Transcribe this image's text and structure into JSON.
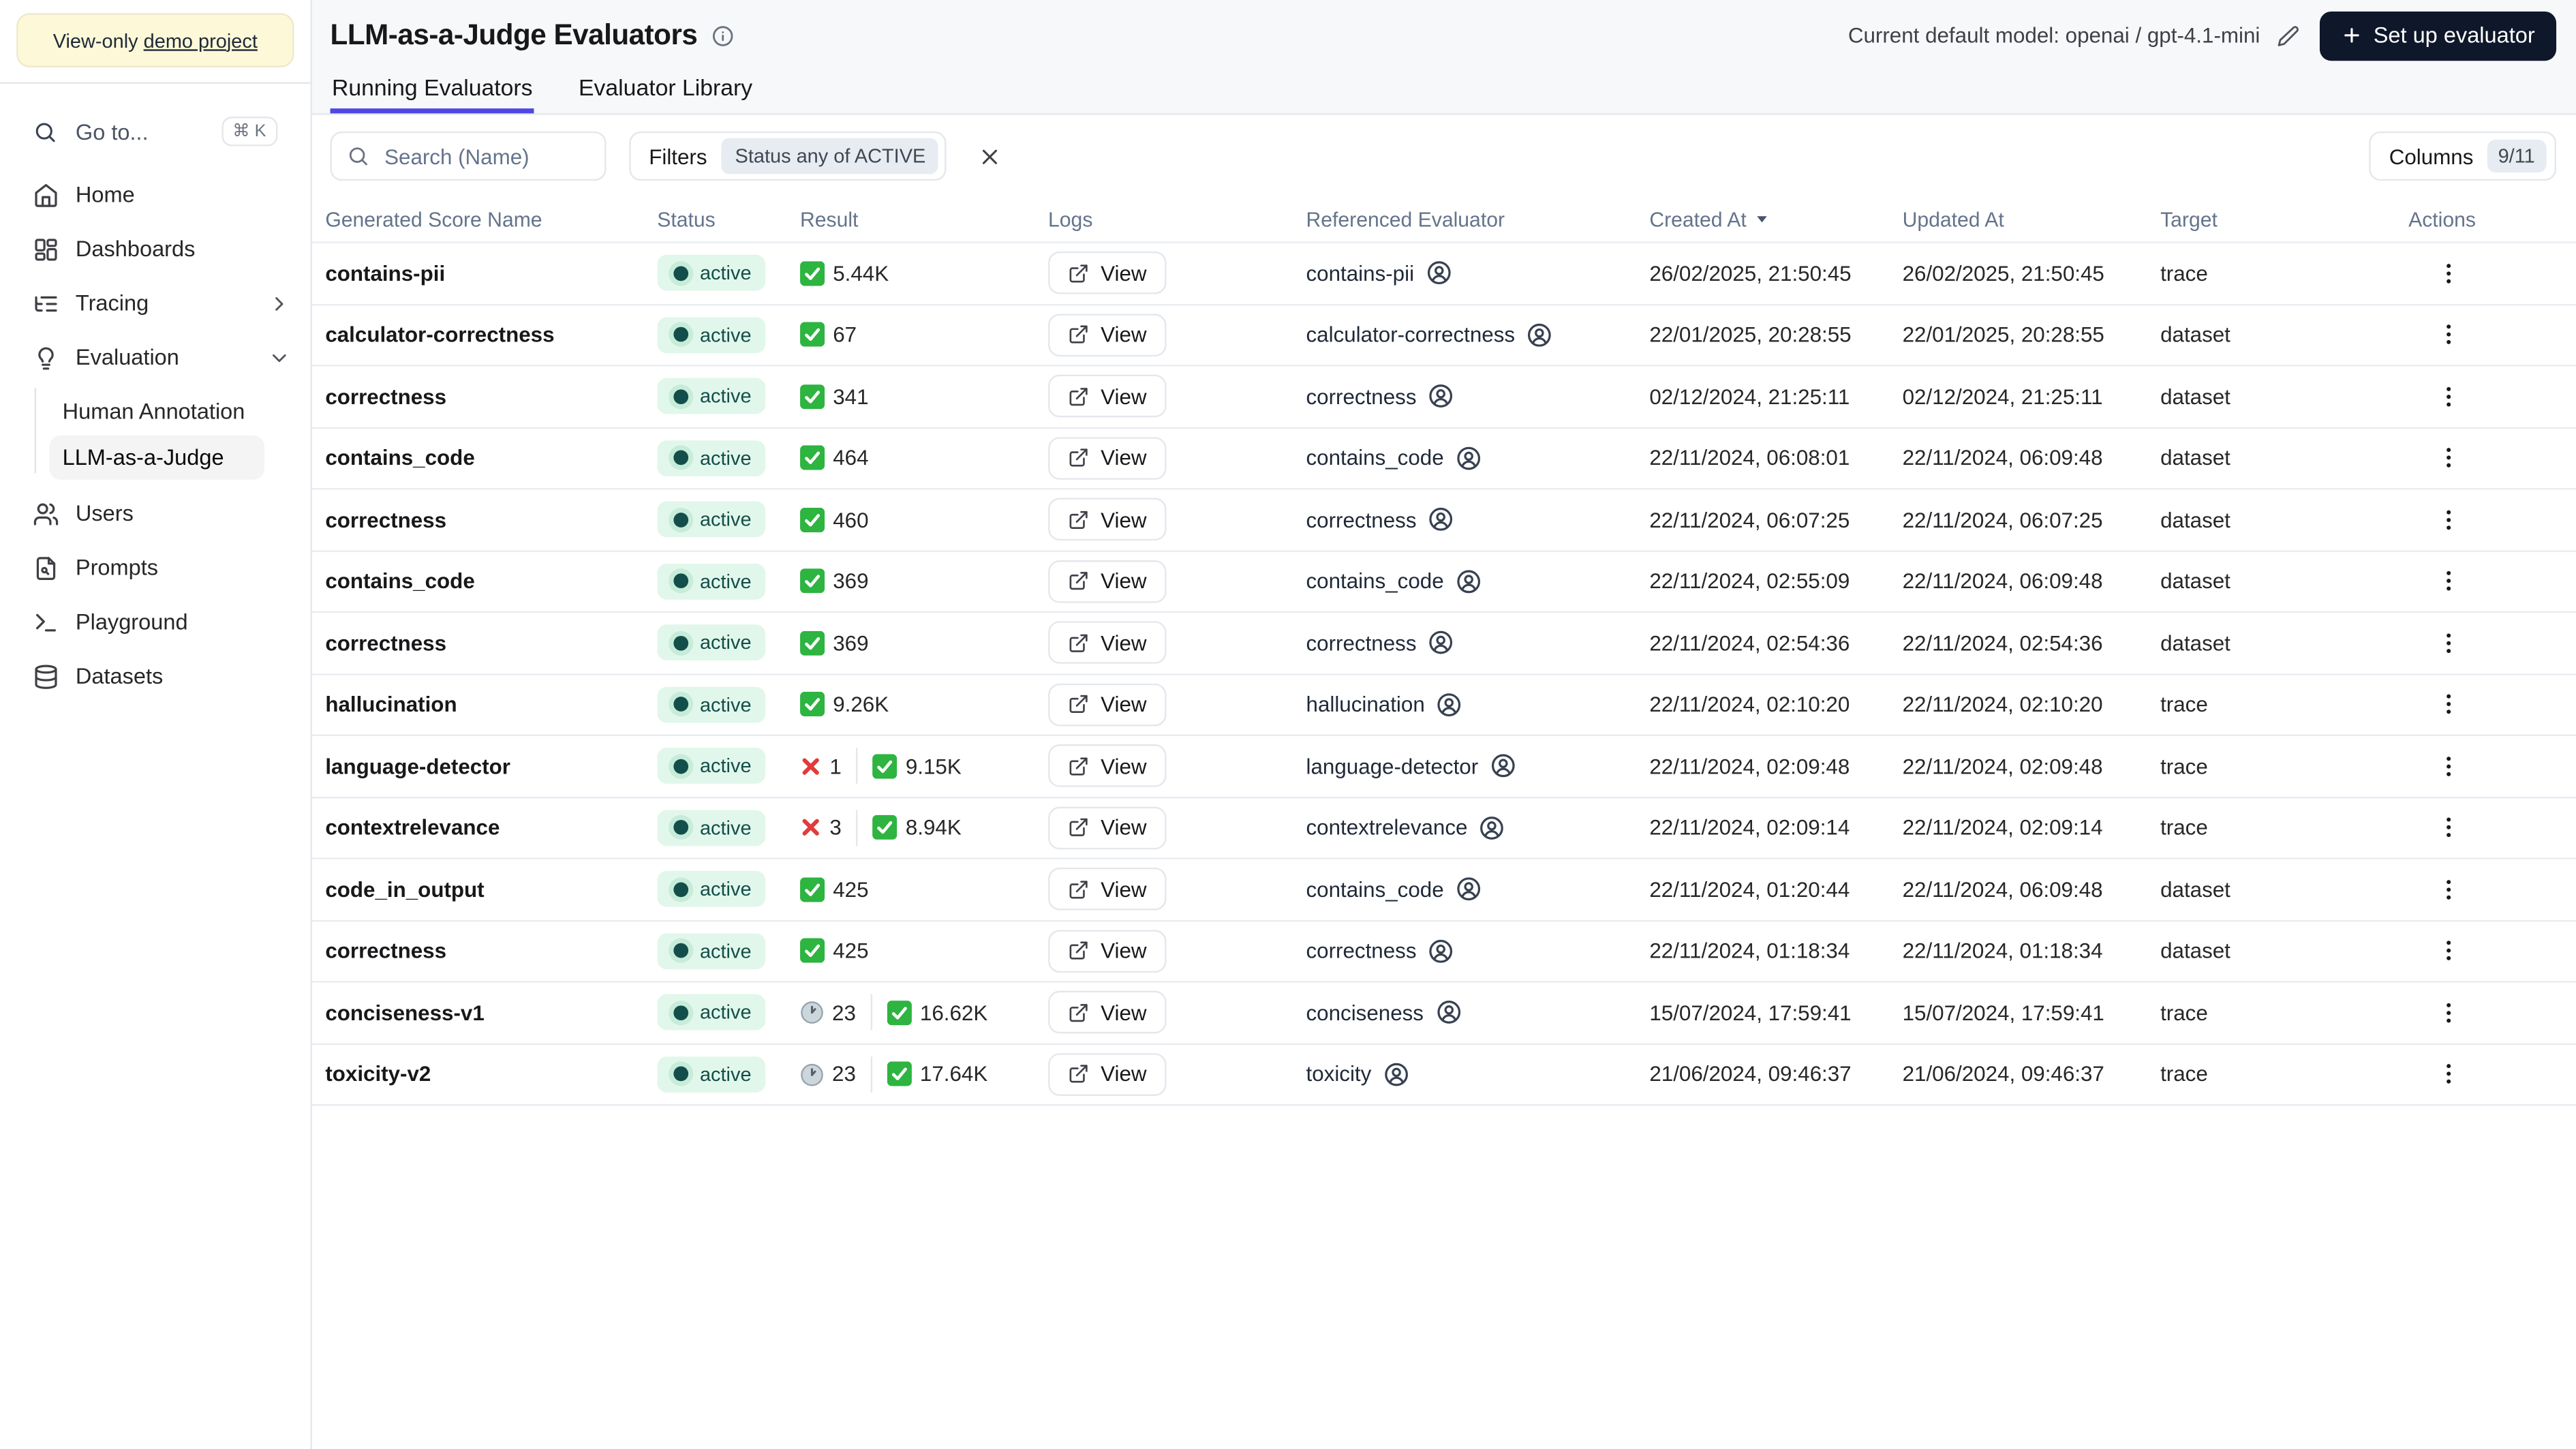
{
  "sidebar": {
    "banner": {
      "prefix": "View-only ",
      "link": "demo project"
    },
    "goto": {
      "label": "Go to...",
      "shortcut": "⌘ K"
    },
    "items": [
      {
        "label": "Home",
        "icon": "home"
      },
      {
        "label": "Dashboards",
        "icon": "dashboards"
      },
      {
        "label": "Tracing",
        "icon": "tracing",
        "trailing": "chevron-right"
      },
      {
        "label": "Evaluation",
        "icon": "evaluation",
        "trailing": "chevron-down",
        "children": [
          {
            "label": "Human Annotation",
            "active": false
          },
          {
            "label": "LLM-as-a-Judge",
            "active": true
          }
        ]
      },
      {
        "label": "Users",
        "icon": "users"
      },
      {
        "label": "Prompts",
        "icon": "prompts"
      },
      {
        "label": "Playground",
        "icon": "playground"
      },
      {
        "label": "Datasets",
        "icon": "datasets"
      }
    ]
  },
  "header": {
    "title": "LLM-as-a-Judge Evaluators",
    "model_label": "Current default model: openai / gpt-4.1-mini",
    "setup_button": "Set up evaluator",
    "tabs": [
      {
        "label": "Running Evaluators",
        "active": true
      },
      {
        "label": "Evaluator Library",
        "active": false
      }
    ]
  },
  "toolbar": {
    "search_placeholder": "Search (Name)",
    "filters_label": "Filters",
    "filter_chip": "Status any of ACTIVE",
    "columns_label": "Columns",
    "columns_badge": "9/11"
  },
  "table": {
    "columns": [
      "Generated Score Name",
      "Status",
      "Result",
      "Logs",
      "Referenced Evaluator",
      "Created At",
      "Updated At",
      "Target",
      "Actions"
    ],
    "sorted": {
      "column": "Created At",
      "direction": "desc"
    },
    "logs_label": "View",
    "rows": [
      {
        "name": "contains-pii",
        "status": "active",
        "result": [
          {
            "type": "check",
            "value": "5.44K"
          }
        ],
        "evaluator": "contains-pii",
        "created": "26/02/2025, 21:50:45",
        "updated": "26/02/2025, 21:50:45",
        "target": "trace"
      },
      {
        "name": "calculator-correctness",
        "status": "active",
        "result": [
          {
            "type": "check",
            "value": "67"
          }
        ],
        "evaluator": "calculator-correctness",
        "created": "22/01/2025, 20:28:55",
        "updated": "22/01/2025, 20:28:55",
        "target": "dataset"
      },
      {
        "name": "correctness",
        "status": "active",
        "result": [
          {
            "type": "check",
            "value": "341"
          }
        ],
        "evaluator": "correctness",
        "created": "02/12/2024, 21:25:11",
        "updated": "02/12/2024, 21:25:11",
        "target": "dataset"
      },
      {
        "name": "contains_code",
        "status": "active",
        "result": [
          {
            "type": "check",
            "value": "464"
          }
        ],
        "evaluator": "contains_code",
        "created": "22/11/2024, 06:08:01",
        "updated": "22/11/2024, 06:09:48",
        "target": "dataset"
      },
      {
        "name": "correctness",
        "status": "active",
        "result": [
          {
            "type": "check",
            "value": "460"
          }
        ],
        "evaluator": "correctness",
        "created": "22/11/2024, 06:07:25",
        "updated": "22/11/2024, 06:07:25",
        "target": "dataset"
      },
      {
        "name": "contains_code",
        "status": "active",
        "result": [
          {
            "type": "check",
            "value": "369"
          }
        ],
        "evaluator": "contains_code",
        "created": "22/11/2024, 02:55:09",
        "updated": "22/11/2024, 06:09:48",
        "target": "dataset"
      },
      {
        "name": "correctness",
        "status": "active",
        "result": [
          {
            "type": "check",
            "value": "369"
          }
        ],
        "evaluator": "correctness",
        "created": "22/11/2024, 02:54:36",
        "updated": "22/11/2024, 02:54:36",
        "target": "dataset"
      },
      {
        "name": "hallucination",
        "status": "active",
        "result": [
          {
            "type": "check",
            "value": "9.26K"
          }
        ],
        "evaluator": "hallucination",
        "created": "22/11/2024, 02:10:20",
        "updated": "22/11/2024, 02:10:20",
        "target": "trace"
      },
      {
        "name": "language-detector",
        "status": "active",
        "result": [
          {
            "type": "cross",
            "value": "1"
          },
          {
            "type": "check",
            "value": "9.15K"
          }
        ],
        "evaluator": "language-detector",
        "created": "22/11/2024, 02:09:48",
        "updated": "22/11/2024, 02:09:48",
        "target": "trace"
      },
      {
        "name": "contextrelevance",
        "status": "active",
        "result": [
          {
            "type": "cross",
            "value": "3"
          },
          {
            "type": "check",
            "value": "8.94K"
          }
        ],
        "evaluator": "contextrelevance",
        "created": "22/11/2024, 02:09:14",
        "updated": "22/11/2024, 02:09:14",
        "target": "trace"
      },
      {
        "name": "code_in_output",
        "status": "active",
        "result": [
          {
            "type": "check",
            "value": "425"
          }
        ],
        "evaluator": "contains_code",
        "created": "22/11/2024, 01:20:44",
        "updated": "22/11/2024, 06:09:48",
        "target": "dataset"
      },
      {
        "name": "correctness",
        "status": "active",
        "result": [
          {
            "type": "check",
            "value": "425"
          }
        ],
        "evaluator": "correctness",
        "created": "22/11/2024, 01:18:34",
        "updated": "22/11/2024, 01:18:34",
        "target": "dataset"
      },
      {
        "name": "conciseness-v1",
        "status": "active",
        "result": [
          {
            "type": "clock",
            "value": "23"
          },
          {
            "type": "check",
            "value": "16.62K"
          }
        ],
        "evaluator": "conciseness",
        "created": "15/07/2024, 17:59:41",
        "updated": "15/07/2024, 17:59:41",
        "target": "trace"
      },
      {
        "name": "toxicity-v2",
        "status": "active",
        "result": [
          {
            "type": "clock",
            "value": "23"
          },
          {
            "type": "check",
            "value": "17.64K"
          }
        ],
        "evaluator": "toxicity",
        "created": "21/06/2024, 09:46:37",
        "updated": "21/06/2024, 09:46:37",
        "target": "trace"
      }
    ]
  },
  "colors": {
    "accent_tab": "#4f46e5",
    "status_pill_bg": "#e2f7eb",
    "status_dot": "#134e4a",
    "setup_button_bg": "#0f172a",
    "banner_bg": "#fdf8d8",
    "check_green": "#2eb440",
    "cross_red": "#e23b3b"
  }
}
